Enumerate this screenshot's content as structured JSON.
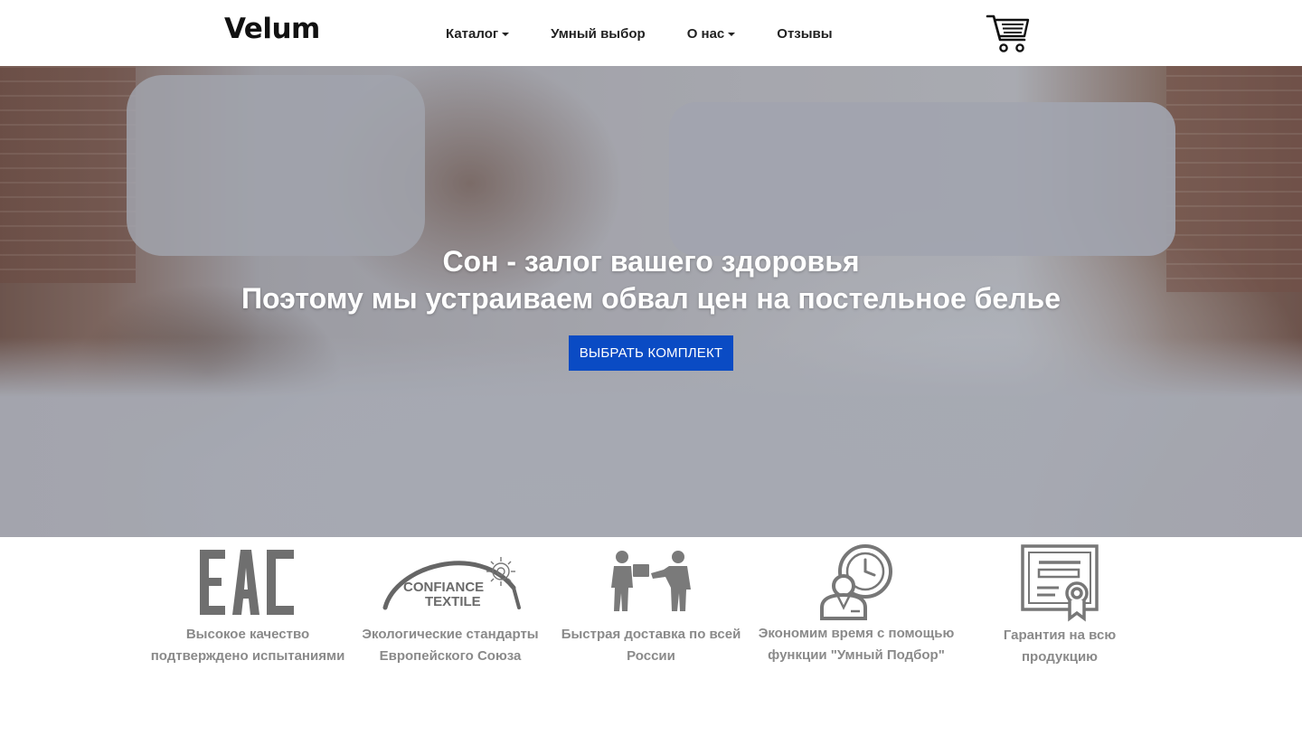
{
  "header": {
    "logo": "Velum",
    "nav": [
      {
        "label": "Каталог",
        "has_dropdown": true
      },
      {
        "label": "Умный выбор",
        "has_dropdown": false
      },
      {
        "label": "О нас",
        "has_dropdown": true
      },
      {
        "label": "Отзывы",
        "has_dropdown": false
      }
    ],
    "cart_icon": "shopping-cart-icon"
  },
  "hero": {
    "title_line1": "Сон - залог вашего здоровья",
    "title_line2": "Поэтому мы устраиваем обвал цен на постельное белье",
    "button_label": "ВЫБРАТЬ КОМПЛЕКТ",
    "button_color": "#0a4bc4"
  },
  "features": [
    {
      "icon": "eac-icon",
      "icon_text": "EAC",
      "line1": "Высокое качество",
      "line2": "подтверждено испытаниями"
    },
    {
      "icon": "confiance-textile-icon",
      "icon_text_1": "CONFIANCE",
      "icon_text_2": "TEXTILE",
      "line1": "Экологические стандарты",
      "line2": "Европейского Союза"
    },
    {
      "icon": "delivery-icon",
      "line1": "Быстрая доставка по всей",
      "line2": "России"
    },
    {
      "icon": "time-saving-icon",
      "line1": "Экономим время с помощью",
      "line2": "функции \"Умный Подбор\""
    },
    {
      "icon": "certificate-icon",
      "line1": "Гарантия на всю",
      "line2": "продукцию"
    }
  ],
  "colors": {
    "feature_text": "#8a8a8a",
    "icon_gray": "#777777"
  }
}
